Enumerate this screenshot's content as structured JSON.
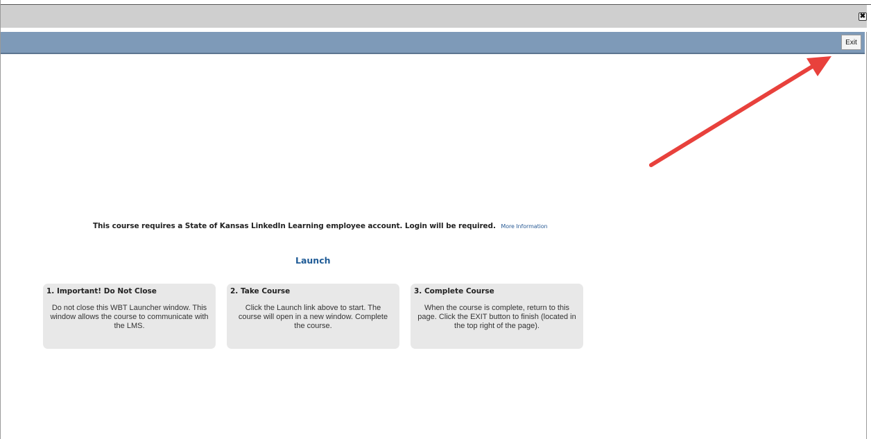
{
  "window": {
    "close_icon": "close-icon"
  },
  "header": {
    "exit_label": "Exit"
  },
  "notice": {
    "text": "This course requires a State of Kansas LinkedIn Learning employee account. Login will be required.",
    "more_info_label": "More Information"
  },
  "launch": {
    "label": "Launch"
  },
  "steps": [
    {
      "title": "1. Important! Do Not Close",
      "body": "Do not close this WBT Launcher window. This window allows the course to communicate with the LMS."
    },
    {
      "title": "2. Take Course",
      "body": "Click the Launch link above to start. The course will open in a new window. Complete the course."
    },
    {
      "title": "3. Complete Course",
      "body": "When the course is complete, return to this page. Click the EXIT button to finish (located in the top right of the page)."
    }
  ],
  "annotation": {
    "arrow_color": "#e8413c",
    "arrow_icon": "red-arrow-pointer"
  },
  "colors": {
    "header_bar": "#7e9ab8",
    "titlebar": "#cfcfcf",
    "card_bg": "#e8e8e8",
    "link": "#1f5b96"
  }
}
